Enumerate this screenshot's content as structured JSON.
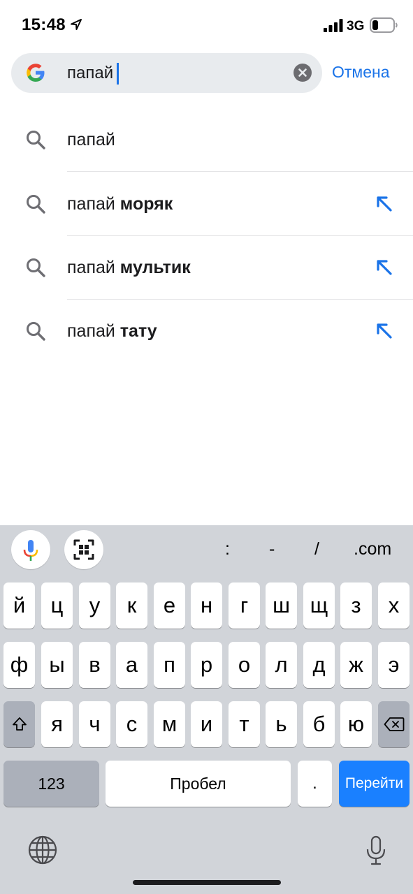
{
  "status_bar": {
    "time": "15:48",
    "network": "3G",
    "icons": [
      "location-arrow-icon",
      "signal-bars-icon",
      "battery-icon"
    ]
  },
  "search": {
    "value": "папай",
    "cancel_label": "Отмена",
    "icons": [
      "google-logo",
      "clear-icon"
    ]
  },
  "suggestions": [
    {
      "prefix": "папай",
      "bold": "",
      "fill_arrow": false
    },
    {
      "prefix": "папай ",
      "bold": "моряк",
      "fill_arrow": true
    },
    {
      "prefix": "папай ",
      "bold": "мультик",
      "fill_arrow": true
    },
    {
      "prefix": "папай ",
      "bold": "тату",
      "fill_arrow": true
    }
  ],
  "keyboard": {
    "toolbar": {
      "icons": [
        "microphone-icon",
        "qr-scan-icon"
      ],
      "shortcuts": [
        ":",
        "-",
        "/",
        ".com"
      ]
    },
    "row1": [
      "й",
      "ц",
      "у",
      "к",
      "е",
      "н",
      "г",
      "ш",
      "щ",
      "з",
      "х"
    ],
    "row2": [
      "ф",
      "ы",
      "в",
      "а",
      "п",
      "р",
      "о",
      "л",
      "д",
      "ж",
      "э"
    ],
    "row3": [
      "я",
      "ч",
      "с",
      "м",
      "и",
      "т",
      "ь",
      "б",
      "ю"
    ],
    "row4": {
      "numbers_label": "123",
      "space_label": "Пробел",
      "period_label": ".",
      "go_label": "Перейти"
    },
    "bottom_icons": [
      "globe-icon",
      "dictation-icon"
    ],
    "accent_color": "#1a80ff"
  },
  "colors": {
    "link": "#1a73e8",
    "search_bg": "#e8ebee",
    "keyboard_bg": "#d1d4d9"
  }
}
